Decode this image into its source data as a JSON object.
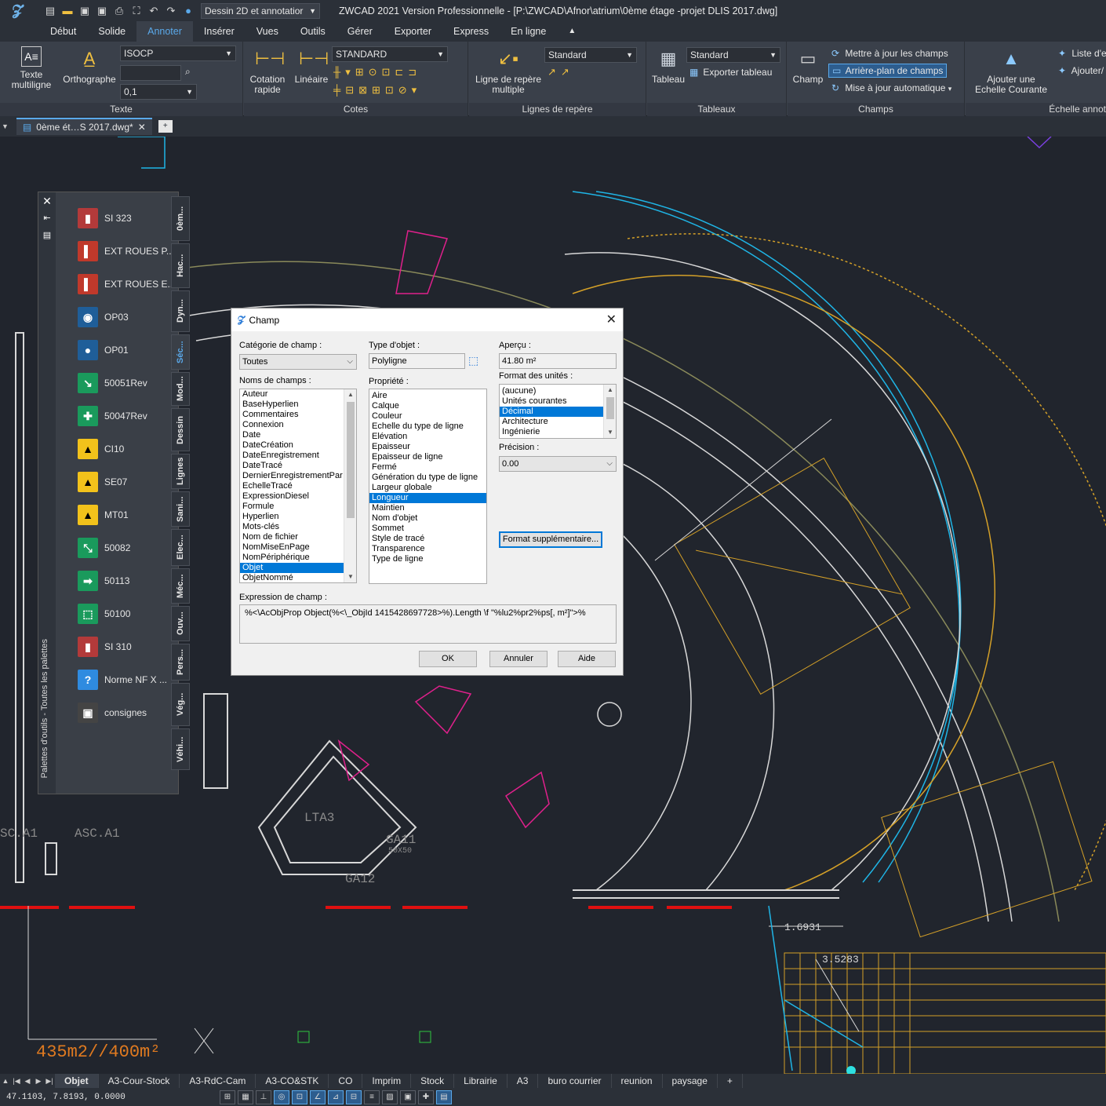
{
  "titlebar": {
    "workspace": "Dessin 2D et annotatior",
    "title": "ZWCAD 2021 Version Professionnelle - [P:\\ZWCAD\\Afnor\\atrium\\0ème étage -projet DLIS 2017.dwg]"
  },
  "ribbon_tabs": [
    "Début",
    "Solide",
    "Annoter",
    "Insérer",
    "Vues",
    "Outils",
    "Gérer",
    "Exporter",
    "Express",
    "En ligne"
  ],
  "ribbon": {
    "texte": {
      "title": "Texte",
      "mtext_label1": "Texte",
      "mtext_label2": "multiligne",
      "ortho_label": "Orthographe",
      "style_value": "ISOCP",
      "height_value": "0,1"
    },
    "cotes": {
      "title": "Cotes",
      "rapid_label1": "Cotation",
      "rapid_label2": "rapide",
      "linear_label": "Linéaire",
      "style_value": "STANDARD"
    },
    "leaders": {
      "title": "Lignes de repère",
      "multi_label1": "Ligne de repère",
      "multi_label2": "multiple",
      "style_value": "Standard"
    },
    "tables": {
      "title": "Tableaux",
      "table_label": "Tableau",
      "style_value": "Standard",
      "export_label": "Exporter tableau"
    },
    "champs": {
      "title": "Champs",
      "field_label": "Champ",
      "update_label": "Mettre à jour les champs",
      "background_label": "Arrière-plan de champs",
      "auto_label": "Mise à jour automatique"
    },
    "echelle": {
      "title": "Échelle annot",
      "add_label1": "Ajouter une",
      "add_label2": "Echelle Courante",
      "list_label": "Liste d'e",
      "ajouter_label": "Ajouter/"
    }
  },
  "document_tab": "0ème ét…S 2017.dwg*",
  "palette": {
    "vertical_title": "Palettes d'outils - Toutes les palettes",
    "items": [
      {
        "label": "SI 323",
        "color": "#b33a3a",
        "glyph": "▮"
      },
      {
        "label": "EXT ROUES P...",
        "color": "#c0392b",
        "glyph": "▌"
      },
      {
        "label": "EXT ROUES E...",
        "color": "#c0392b",
        "glyph": "▌"
      },
      {
        "label": "OP03",
        "color": "#1f5e99",
        "glyph": "◉"
      },
      {
        "label": "OP01",
        "color": "#1f5e99",
        "glyph": "●"
      },
      {
        "label": "50051Rev",
        "color": "#1a9a5c",
        "glyph": "↘"
      },
      {
        "label": "50047Rev",
        "color": "#1a9a5c",
        "glyph": "✚"
      },
      {
        "label": "CI10",
        "color": "#f2c21b",
        "glyph": "▲"
      },
      {
        "label": "SE07",
        "color": "#f2c21b",
        "glyph": "▲"
      },
      {
        "label": "MT01",
        "color": "#f2c21b",
        "glyph": "▲"
      },
      {
        "label": "50082",
        "color": "#1a9a5c",
        "glyph": "⤡"
      },
      {
        "label": "50113",
        "color": "#1a9a5c",
        "glyph": "➡"
      },
      {
        "label": "50100",
        "color": "#1a9a5c",
        "glyph": "⬚"
      },
      {
        "label": "SI 310",
        "color": "#b33a3a",
        "glyph": "▮"
      },
      {
        "label": "Norme NF X ...",
        "color": "#2f8be0",
        "glyph": "?"
      },
      {
        "label": "consignes",
        "color": "#444444",
        "glyph": "▣"
      }
    ],
    "tabs": [
      "0èm...",
      "Hac...",
      "Dyn...",
      "Séc...",
      "Mod...",
      "Dessin",
      "Lignes",
      "Sani...",
      "Elec...",
      "Méc...",
      "Ouv...",
      "Pers...",
      "Vég...",
      "Véhi..."
    ]
  },
  "dialog": {
    "title": "Champ",
    "category_label": "Catégorie de champ :",
    "category_value": "Toutes",
    "names_label": "Noms de champs :",
    "field_names": [
      "Auteur",
      "BaseHyperlien",
      "Commentaires",
      "Connexion",
      "Date",
      "DateCréation",
      "DateEnregistrement",
      "DateTracé",
      "DernierEnregistrementPar",
      "EchelleTracé",
      "ExpressionDiesel",
      "Formule",
      "Hyperlien",
      "Mots-clés",
      "Nom de fichier",
      "NomMiseEnPage",
      "NomPériphérique",
      "Objet",
      "ObjetNommé"
    ],
    "field_selected": "Objet",
    "object_type_label": "Type d'objet :",
    "object_type_value": "Polyligne",
    "property_label": "Propriété :",
    "properties": [
      "Aire",
      "Calque",
      "Couleur",
      "Echelle du type de ligne",
      "Elévation",
      "Epaisseur",
      "Epaisseur de ligne",
      "Fermé",
      "Génération du type de ligne",
      "Largeur globale",
      "Longueur",
      "Maintien",
      "Nom d'objet",
      "Sommet",
      "Style de tracé",
      "Transparence",
      "Type de ligne"
    ],
    "property_selected": "Longueur",
    "preview_label": "Aperçu :",
    "preview_value": "41.80 m²",
    "units_label": "Format des unités :",
    "units": [
      "(aucune)",
      "Unités courantes",
      "Décimal",
      "Architecture",
      "Ingénierie"
    ],
    "units_selected": "Décimal",
    "precision_label": "Précision :",
    "precision_value": "0.00",
    "format_button": "Format supplémentaire...",
    "expression_label": "Expression de champ :",
    "expression_value": "%<\\AcObjProp Object(%<\\_ObjId 1415428697728>%).Length \\f \"%lu2%pr2%ps[, m²]\">%",
    "ok": "OK",
    "cancel": "Annuler",
    "help": "Aide"
  },
  "drawing": {
    "labels": [
      "LTA3",
      "GA11",
      "50X50",
      "GA12",
      "ASC.A1",
      "SC.A1",
      "1.6931",
      "3.5283"
    ],
    "area_text": "435m2//400m²"
  },
  "layout_tabs": [
    "Objet",
    "A3-Cour-Stock",
    "A3-RdC-Cam",
    "A3-CO&STK",
    "CO",
    "Imprim",
    "Stock",
    "Librairie",
    "A3",
    "buro courrier",
    "reunion",
    "paysage",
    "+"
  ],
  "layout_active": "Objet",
  "status": {
    "coords": "47.1103, 7.8193, 0.0000"
  }
}
